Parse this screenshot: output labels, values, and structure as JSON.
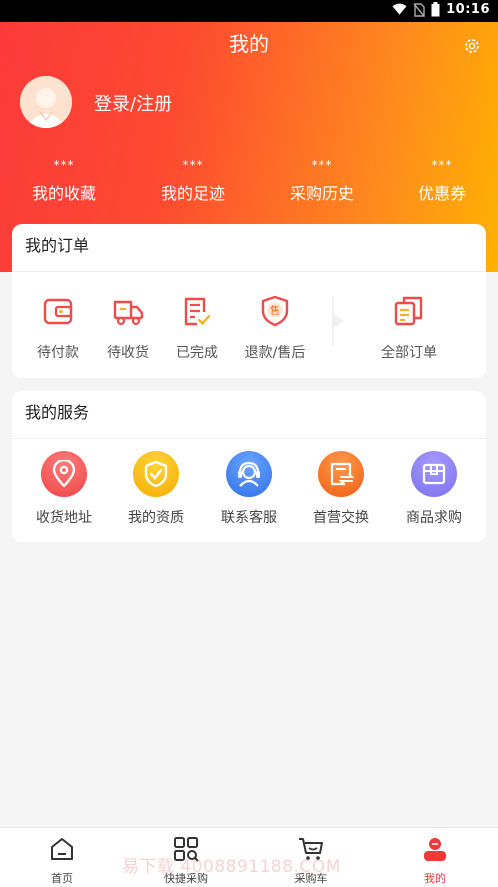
{
  "status_bar": {
    "time": "10:16"
  },
  "header": {
    "title": "我的",
    "login_label": "登录/注册"
  },
  "stats": [
    {
      "value": "***",
      "label": "我的收藏"
    },
    {
      "value": "***",
      "label": "我的足迹"
    },
    {
      "value": "***",
      "label": "采购历史"
    },
    {
      "value": "***",
      "label": "优惠券"
    }
  ],
  "orders": {
    "title": "我的订单",
    "items": [
      {
        "label": "待付款",
        "icon": "wallet-icon"
      },
      {
        "label": "待收货",
        "icon": "truck-icon"
      },
      {
        "label": "已完成",
        "icon": "checklist-icon"
      },
      {
        "label": "退款/售后",
        "icon": "after-sale-shield-icon",
        "glyph": "售"
      },
      {
        "label": "全部订单",
        "icon": "documents-icon"
      }
    ]
  },
  "services": {
    "title": "我的服务",
    "items": [
      {
        "label": "收货地址",
        "icon": "location-pin-icon",
        "color": "#f25a5a"
      },
      {
        "label": "我的资质",
        "icon": "shield-check-icon",
        "color": "#f7b500"
      },
      {
        "label": "联系客服",
        "icon": "customer-service-icon",
        "color": "#3a7ef5"
      },
      {
        "label": "首营交换",
        "icon": "exchange-icon",
        "color": "#f26a1e"
      },
      {
        "label": "商品求购",
        "icon": "box-icon",
        "color": "#8a7ef5"
      }
    ]
  },
  "tabbar": [
    {
      "label": "首页",
      "icon": "home-icon"
    },
    {
      "label": "快捷采购",
      "icon": "grid-search-icon"
    },
    {
      "label": "采购车",
      "icon": "cart-icon"
    },
    {
      "label": "我的",
      "icon": "profile-icon",
      "active": true
    }
  ],
  "watermark": "易下载 4008891188.COM",
  "colors": {
    "accent": "#f03a3a",
    "gradient_start": "#fc3a3a",
    "gradient_end": "#ffb100"
  }
}
